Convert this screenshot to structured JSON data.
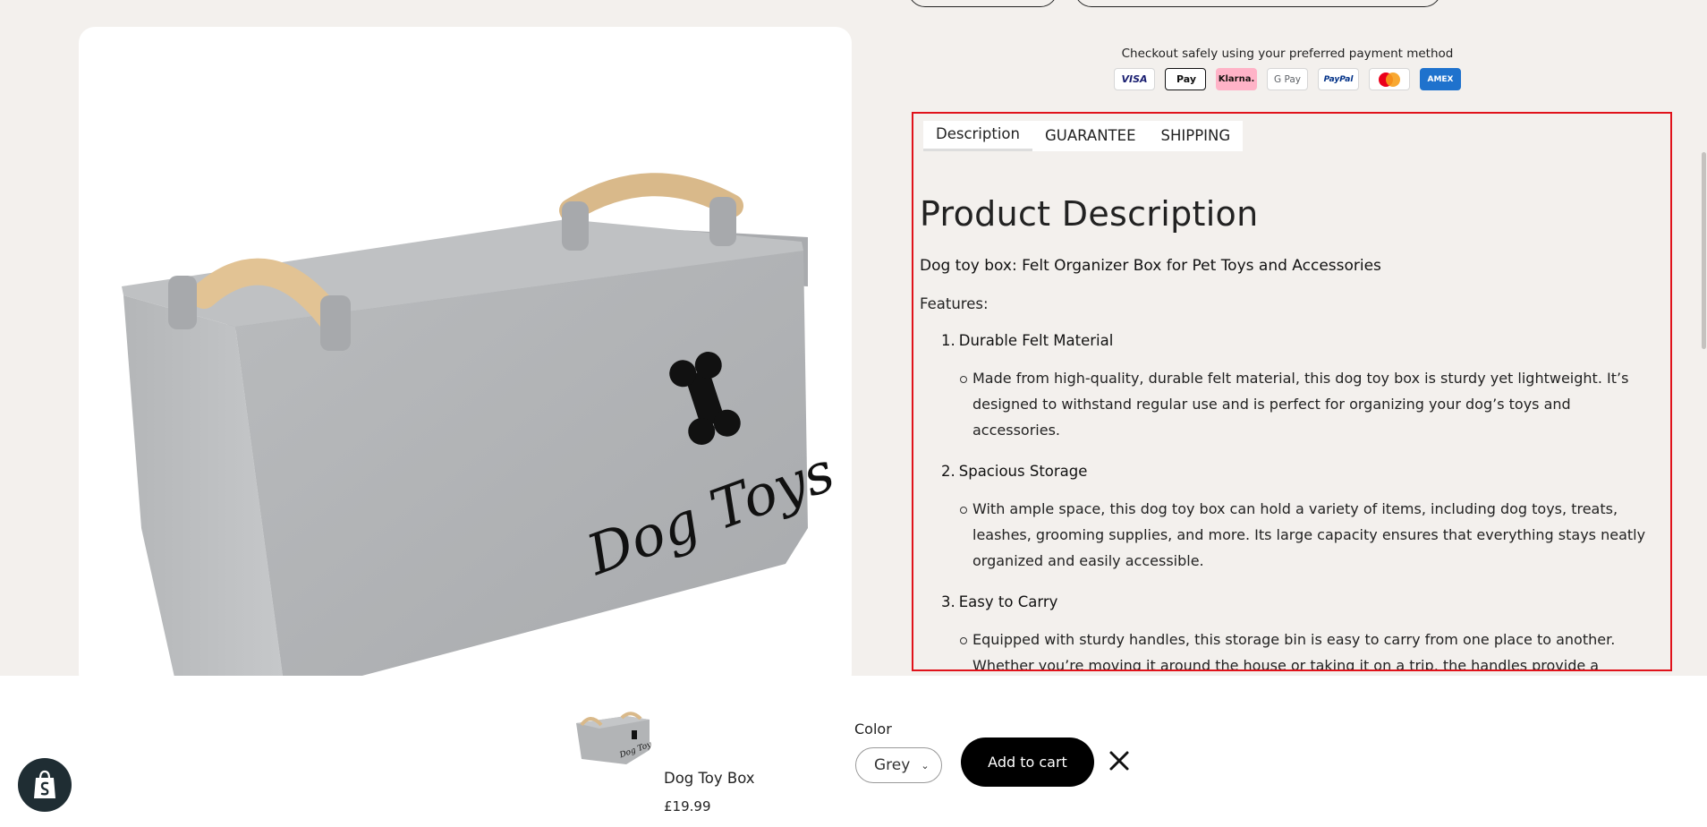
{
  "payment": {
    "label": "Checkout safely using your preferred payment method",
    "methods": [
      {
        "name": "Visa",
        "text": "VISA",
        "icon": "visa-icon"
      },
      {
        "name": "Apple Pay",
        "text": "Pay",
        "icon": "apple-pay-icon"
      },
      {
        "name": "Klarna",
        "text": "Klarna.",
        "icon": "klarna-icon"
      },
      {
        "name": "Google Pay",
        "text": "G Pay",
        "icon": "google-pay-icon"
      },
      {
        "name": "PayPal",
        "text": "PayPal",
        "icon": "paypal-icon"
      },
      {
        "name": "Mastercard",
        "text": "",
        "icon": "mastercard-icon"
      },
      {
        "name": "American Express",
        "text": "AMEX",
        "icon": "amex-icon"
      }
    ]
  },
  "tabs": [
    {
      "label": "Description",
      "active": true
    },
    {
      "label": "GUARANTEE",
      "active": false
    },
    {
      "label": "SHIPPING",
      "active": false
    }
  ],
  "description": {
    "heading": "Product Description",
    "subtitle": "Dog toy box: Felt Organizer Box for Pet Toys and Accessories",
    "features_label": "Features:",
    "features": [
      {
        "number": "1.",
        "title": "Durable Felt Material",
        "text": "Made from high-quality, durable felt material, this dog toy box is sturdy yet lightweight. It’s designed to withstand regular use and is perfect for organizing your dog’s toys and accessories."
      },
      {
        "number": "2.",
        "title": "Spacious Storage",
        "text": "With ample space, this dog toy box can hold a variety of items, including dog toys, treats, leashes, grooming supplies, and more. Its large capacity ensures that everything stays neatly organized and easily accessible."
      },
      {
        "number": "3.",
        "title": "Easy to Carry",
        "text": "Equipped with sturdy handles, this storage bin is easy to carry from one place to another. Whether you’re moving it around the house or taking it on a trip, the handles provide a comfortable grip for"
      }
    ]
  },
  "product_image": {
    "label": "Dog Toys"
  },
  "sticky": {
    "product_name": "Dog Toy Box",
    "price": "£19.99",
    "color_label": "Color",
    "color_value": "Grey",
    "add_to_cart": "Add to cart"
  },
  "colors": {
    "accent": "#000000",
    "highlight_border": "#e0121b",
    "background": "#f3f0ed"
  }
}
